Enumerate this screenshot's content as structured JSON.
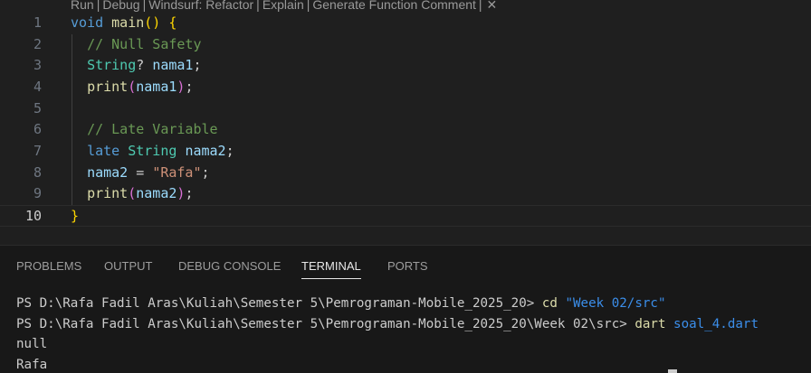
{
  "editor": {
    "codelens": {
      "items": [
        "Run",
        "Debug",
        "Windsurf: Refactor",
        "Explain",
        "Generate Function Comment"
      ],
      "separator": "|",
      "close_glyph": "✕"
    },
    "lines": [
      {
        "n": "1",
        "tokens": [
          [
            "kw",
            "void"
          ],
          [
            "txt",
            " "
          ],
          [
            "fn",
            "main"
          ],
          [
            "p1",
            "()"
          ],
          [
            "txt",
            " "
          ],
          [
            "p1",
            "{"
          ]
        ]
      },
      {
        "n": "2",
        "tokens": [
          [
            "txt",
            "  "
          ],
          [
            "cm",
            "// Null Safety"
          ]
        ]
      },
      {
        "n": "3",
        "tokens": [
          [
            "txt",
            "  "
          ],
          [
            "ty",
            "String"
          ],
          [
            "txt",
            "? "
          ],
          [
            "var",
            "nama1"
          ],
          [
            "txt",
            ";"
          ]
        ]
      },
      {
        "n": "4",
        "tokens": [
          [
            "txt",
            "  "
          ],
          [
            "fn",
            "print"
          ],
          [
            "p2",
            "("
          ],
          [
            "var",
            "nama1"
          ],
          [
            "p2",
            ")"
          ],
          [
            "txt",
            ";"
          ]
        ]
      },
      {
        "n": "5",
        "tokens": []
      },
      {
        "n": "6",
        "tokens": [
          [
            "txt",
            "  "
          ],
          [
            "cm",
            "// Late Variable"
          ]
        ]
      },
      {
        "n": "7",
        "tokens": [
          [
            "txt",
            "  "
          ],
          [
            "kw",
            "late"
          ],
          [
            "txt",
            " "
          ],
          [
            "ty",
            "String"
          ],
          [
            "txt",
            " "
          ],
          [
            "var",
            "nama2"
          ],
          [
            "txt",
            ";"
          ]
        ]
      },
      {
        "n": "8",
        "tokens": [
          [
            "txt",
            "  "
          ],
          [
            "var",
            "nama2"
          ],
          [
            "txt",
            " = "
          ],
          [
            "str",
            "\"Rafa\""
          ],
          [
            "txt",
            ";"
          ]
        ]
      },
      {
        "n": "9",
        "tokens": [
          [
            "txt",
            "  "
          ],
          [
            "fn",
            "print"
          ],
          [
            "p2",
            "("
          ],
          [
            "var",
            "nama2"
          ],
          [
            "p2",
            ")"
          ],
          [
            "txt",
            ";"
          ]
        ]
      },
      {
        "n": "10",
        "tokens": [
          [
            "p1",
            "}"
          ]
        ]
      }
    ],
    "current_line": "10"
  },
  "panel": {
    "tabs": [
      {
        "label": "PROBLEMS",
        "active": false
      },
      {
        "label": "OUTPUT",
        "active": false
      },
      {
        "label": "DEBUG CONSOLE",
        "active": false
      },
      {
        "label": "TERMINAL",
        "active": true
      },
      {
        "label": "PORTS",
        "active": false
      }
    ],
    "terminal": {
      "line1_prompt": "PS D:\\Rafa Fadil Aras\\Kuliah\\Semester 5\\Pemrograman-Mobile_2025_20> ",
      "line1_cmd": "cd",
      "line1_arg": " \"Week 02/src\"",
      "line2_prompt": "PS D:\\Rafa Fadil Aras\\Kuliah\\Semester 5\\Pemrograman-Mobile_2025_20\\Week 02\\src> ",
      "line2_cmd": "dart",
      "line2_arg": " soal_4.dart",
      "output": [
        "null",
        "Rafa"
      ]
    }
  },
  "colors": {
    "editor_bg": "#1f1f1f",
    "panel_bg": "#181818",
    "keyword": "#569cd6",
    "function": "#dcdcaa",
    "comment": "#6a9955",
    "type": "#4ec9b0",
    "variable": "#9cdcfe",
    "string": "#ce9178"
  }
}
